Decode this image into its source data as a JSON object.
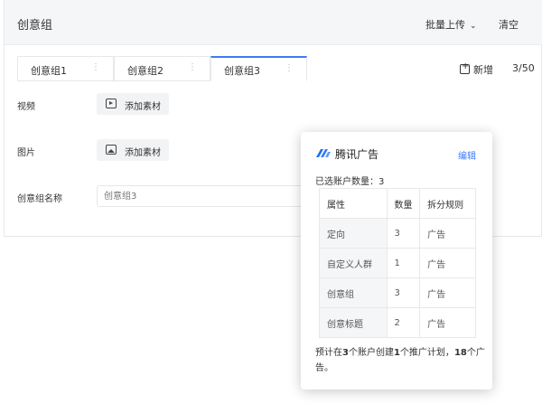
{
  "header": {
    "title": "创意组",
    "batch_upload": "批量上传",
    "clear": "清空"
  },
  "tabs": [
    {
      "label": "创意组1",
      "active": false
    },
    {
      "label": "创意组2",
      "active": false
    },
    {
      "label": "创意组3",
      "active": true
    }
  ],
  "toolbar": {
    "add_new": "新增",
    "count": "3/50"
  },
  "fields": {
    "video_label": "视频",
    "video_button": "添加素材",
    "image_label": "图片",
    "image_button": "添加素材",
    "name_label": "创意组名称",
    "name_placeholder": "创意组3"
  },
  "popup": {
    "brand": "腾讯广告",
    "edit": "编辑",
    "selected_accounts": "已选账户数量：3",
    "columns": [
      "属性",
      "数量",
      "拆分规则"
    ],
    "rows": [
      {
        "attr": "定向",
        "qty": "3",
        "rule": "广告"
      },
      {
        "attr": "自定义人群",
        "qty": "1",
        "rule": "广告"
      },
      {
        "attr": "创意组",
        "qty": "3",
        "rule": "广告"
      },
      {
        "attr": "创意标题",
        "qty": "2",
        "rule": "广告"
      }
    ],
    "summary_parts": [
      "预计在",
      "3",
      "个账户创建",
      "1",
      "个推广计划，",
      "18",
      "个广告。"
    ]
  },
  "colors": {
    "accent": "#3a7cf6",
    "header_bg": "#f5f6f8"
  },
  "icons": {
    "upload_menu": "chevron-down-icon",
    "add_new": "add-square-icon",
    "video": "video-play-icon",
    "image": "image-icon",
    "logo": "tencent-ads-logo-icon"
  }
}
